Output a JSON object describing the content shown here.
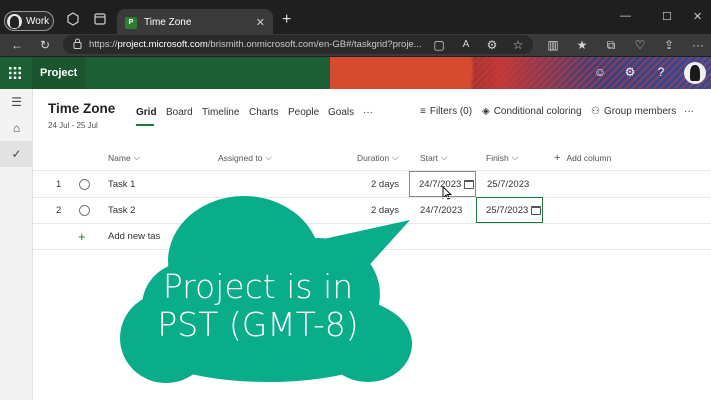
{
  "browser": {
    "profile_label": "Work",
    "tab_title": "Time Zone",
    "tab_favicon_text": "P",
    "url_prefix": "https://",
    "url_host": "project.microsoft.com",
    "url_rest": "/brismith.onmicrosoft.com/en-GB#/taskgrid?proje..."
  },
  "app": {
    "name": "Project",
    "brand_color": "#1d5f34"
  },
  "project": {
    "title": "Time Zone",
    "date_range": "24 Jul - 25 Jul"
  },
  "view_tabs": [
    {
      "label": "Grid",
      "active": true
    },
    {
      "label": "Board"
    },
    {
      "label": "Timeline"
    },
    {
      "label": "Charts"
    },
    {
      "label": "People"
    },
    {
      "label": "Goals"
    },
    {
      "label": "···"
    }
  ],
  "toolbar": {
    "filters_label": "Filters (0)",
    "conditional_label": "Conditional coloring",
    "group_label": "Group members",
    "more_label": "···"
  },
  "grid": {
    "columns": {
      "name": "Name",
      "assigned": "Assigned to",
      "duration": "Duration",
      "start": "Start",
      "finish": "Finish",
      "add_column": "Add column"
    },
    "rows": [
      {
        "num": "1",
        "name": "Task 1",
        "duration": "2 days",
        "start": "24/7/2023",
        "finish": "25/7/2023"
      },
      {
        "num": "2",
        "name": "Task 2",
        "duration": "2 days",
        "start": "24/7/2023",
        "finish": "25/7/2023"
      }
    ],
    "add_task_label": "Add new task"
  },
  "callout": {
    "line1": "Project is in",
    "line2": "PST (GMT-8)",
    "color": "#0aad8a"
  }
}
